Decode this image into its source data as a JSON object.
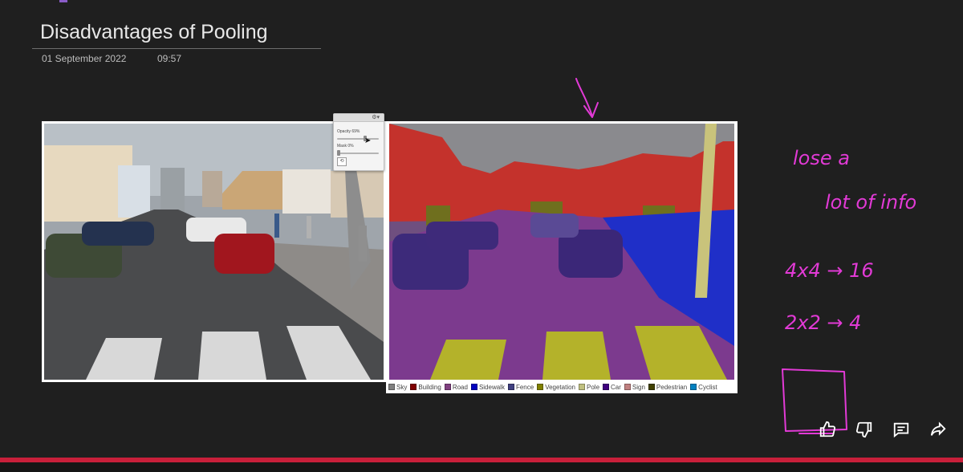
{
  "note": {
    "title": "Disadvantages of Pooling",
    "date": "01 September 2022",
    "time": "09:57"
  },
  "popup": {
    "opacity_label": "Opacity 69%",
    "mask_label": "Mask 0%",
    "opacity_value": 0.69,
    "mask_value": 0.0
  },
  "legend": [
    {
      "label": "Sky",
      "color": "#808080"
    },
    {
      "label": "Building",
      "color": "#800000"
    },
    {
      "label": "Road",
      "color": "#804080"
    },
    {
      "label": "Sidewalk",
      "color": "#0000c0"
    },
    {
      "label": "Fence",
      "color": "#404080"
    },
    {
      "label": "Vegetation",
      "color": "#808000"
    },
    {
      "label": "Pole",
      "color": "#c0c080"
    },
    {
      "label": "Car",
      "color": "#400080"
    },
    {
      "label": "Sign",
      "color": "#c08080"
    },
    {
      "label": "Pedestrian",
      "color": "#404000"
    },
    {
      "label": "Cyclist",
      "color": "#0080c0"
    }
  ],
  "handwriting": {
    "line1": "lose a",
    "line2": "lot of info",
    "line3": "4x4 → 16",
    "line4": "2x2 → 4"
  },
  "ink_color": "#e23ad6",
  "actions": {
    "like": "thumbs-up-icon",
    "dislike": "thumbs-down-icon",
    "comment": "comment-icon",
    "share": "share-icon"
  }
}
